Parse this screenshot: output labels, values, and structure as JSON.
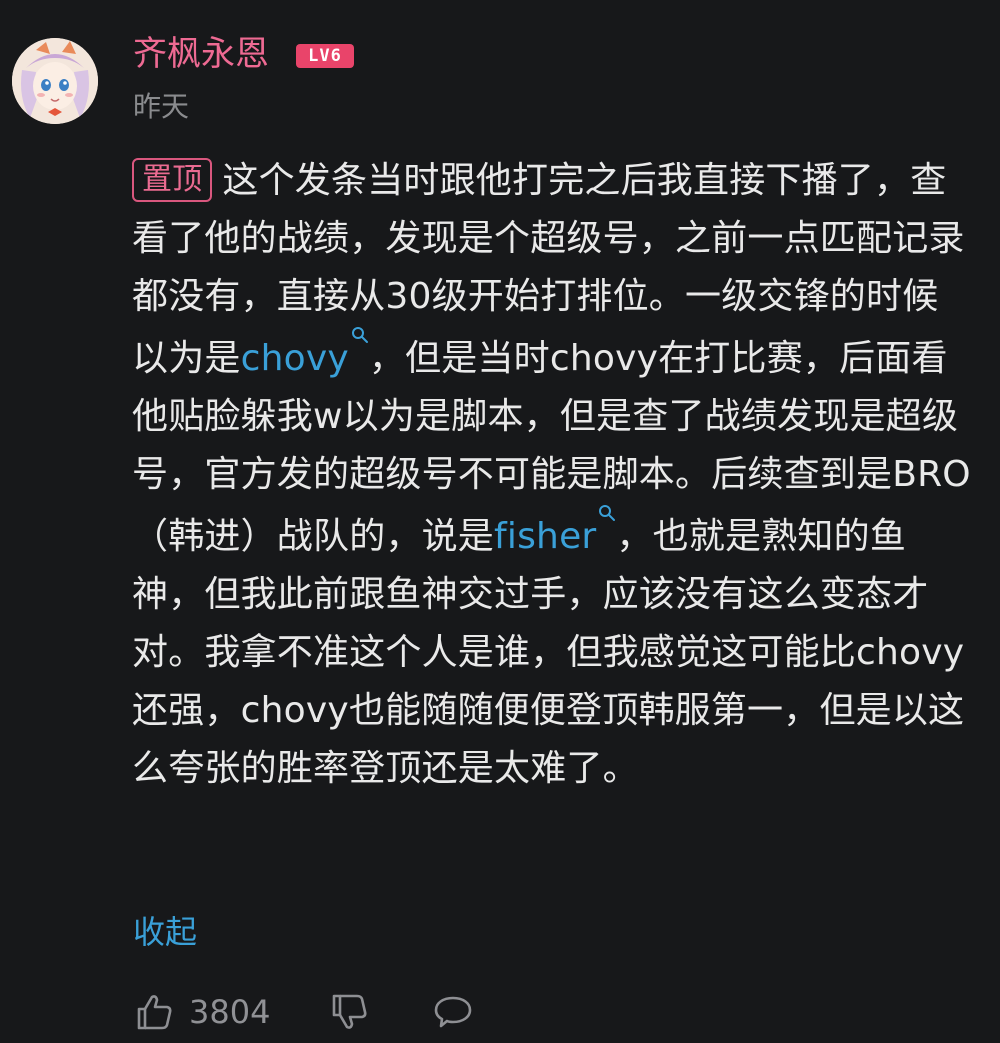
{
  "user": {
    "name": "齐枫永恩",
    "level": "LV6",
    "timestamp": "昨天"
  },
  "comment": {
    "pin_label": "置顶",
    "segments": [
      {
        "text": "这个发条当时跟他打完之后我直接下播了，查看了他的战绩，发现是个超级号，之前一点匹配记录都没有，直接从30级开始打排位。一级交锋的时候以为是",
        "link": false
      },
      {
        "text": "chovy",
        "link": true
      },
      {
        "text": "，但是当时chovy在打比赛，后面看他贴脸躲我w以为是脚本，但是查了战绩发现是超级号，官方发的超级号不可能是脚本。后续查到是BRO（韩进）战队的，说是",
        "link": false
      },
      {
        "text": "fisher",
        "link": true
      },
      {
        "text": "，也就是熟知的鱼神，但我此前跟鱼神交过手，应该没有这么变态才对。我拿不准这个人是谁，但我感觉这可能比chovy还强，chovy也能随随便便登顶韩服第一，但是以这么夸张的胜率登顶还是太难了。",
        "link": false
      }
    ],
    "collapse_label": "收起"
  },
  "actions": {
    "like_count": "3804",
    "icons": [
      "thumbs-up-icon",
      "thumbs-down-icon",
      "reply-bubble-icon"
    ]
  },
  "colors": {
    "background": "#17181a",
    "username": "#ee6a93",
    "level_badge": "#e9446a",
    "link": "#3aa0d8",
    "body_text": "#e9e9e9",
    "muted": "#8a8b8e"
  }
}
